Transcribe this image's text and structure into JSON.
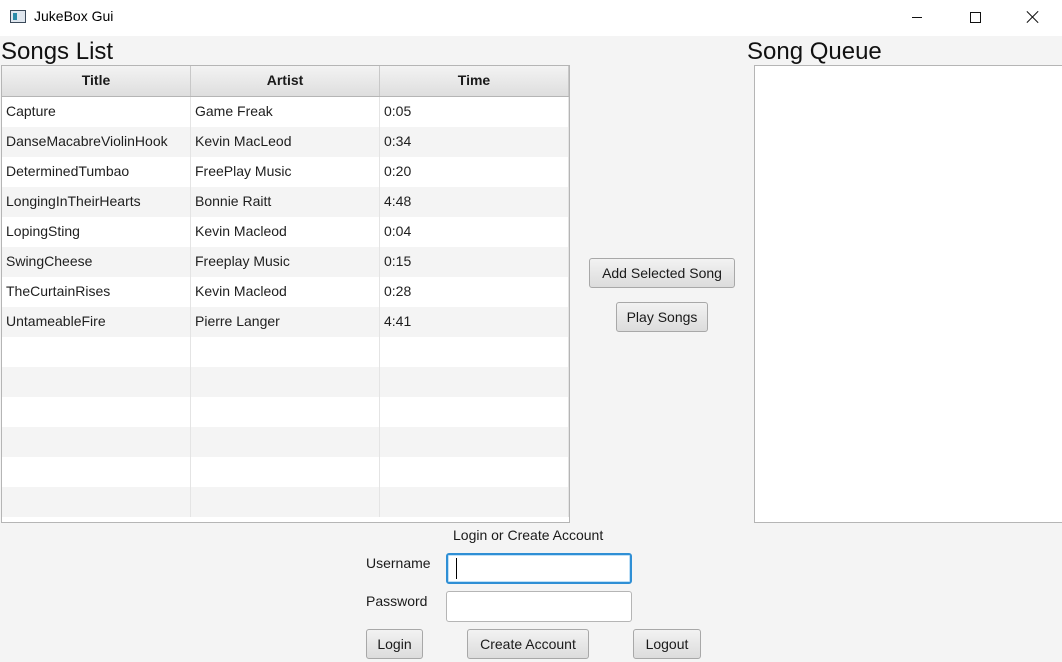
{
  "window": {
    "title": "JukeBox Gui",
    "icon": "app-window-icon"
  },
  "songs_list": {
    "heading": "Songs List",
    "columns": [
      "Title",
      "Artist",
      "Time"
    ],
    "rows": [
      {
        "title": "Capture",
        "artist": "Game Freak",
        "time": "0:05"
      },
      {
        "title": "DanseMacabreViolinHook",
        "artist": "Kevin MacLeod",
        "time": "0:34"
      },
      {
        "title": "DeterminedTumbao",
        "artist": "FreePlay Music",
        "time": "0:20"
      },
      {
        "title": "LongingInTheirHearts",
        "artist": "Bonnie Raitt",
        "time": "4:48"
      },
      {
        "title": "LopingSting",
        "artist": "Kevin Macleod",
        "time": "0:04"
      },
      {
        "title": "SwingCheese",
        "artist": "Freeplay Music",
        "time": "0:15"
      },
      {
        "title": "TheCurtainRises",
        "artist": "Kevin Macleod",
        "time": "0:28"
      },
      {
        "title": "UntameableFire",
        "artist": "Pierre Langer",
        "time": "4:41"
      }
    ]
  },
  "song_queue": {
    "heading": "Song Queue",
    "items": []
  },
  "actions": {
    "add_selected_song": "Add Selected Song",
    "play_songs": "Play Songs"
  },
  "login": {
    "title": "Login or Create Account",
    "username_label": "Username",
    "username_value": "",
    "password_label": "Password",
    "password_value": "",
    "login_button": "Login",
    "create_account_button": "Create Account",
    "logout_button": "Logout"
  },
  "colors": {
    "focus_border": "#2f8fd5",
    "background": "#f4f4f4"
  }
}
